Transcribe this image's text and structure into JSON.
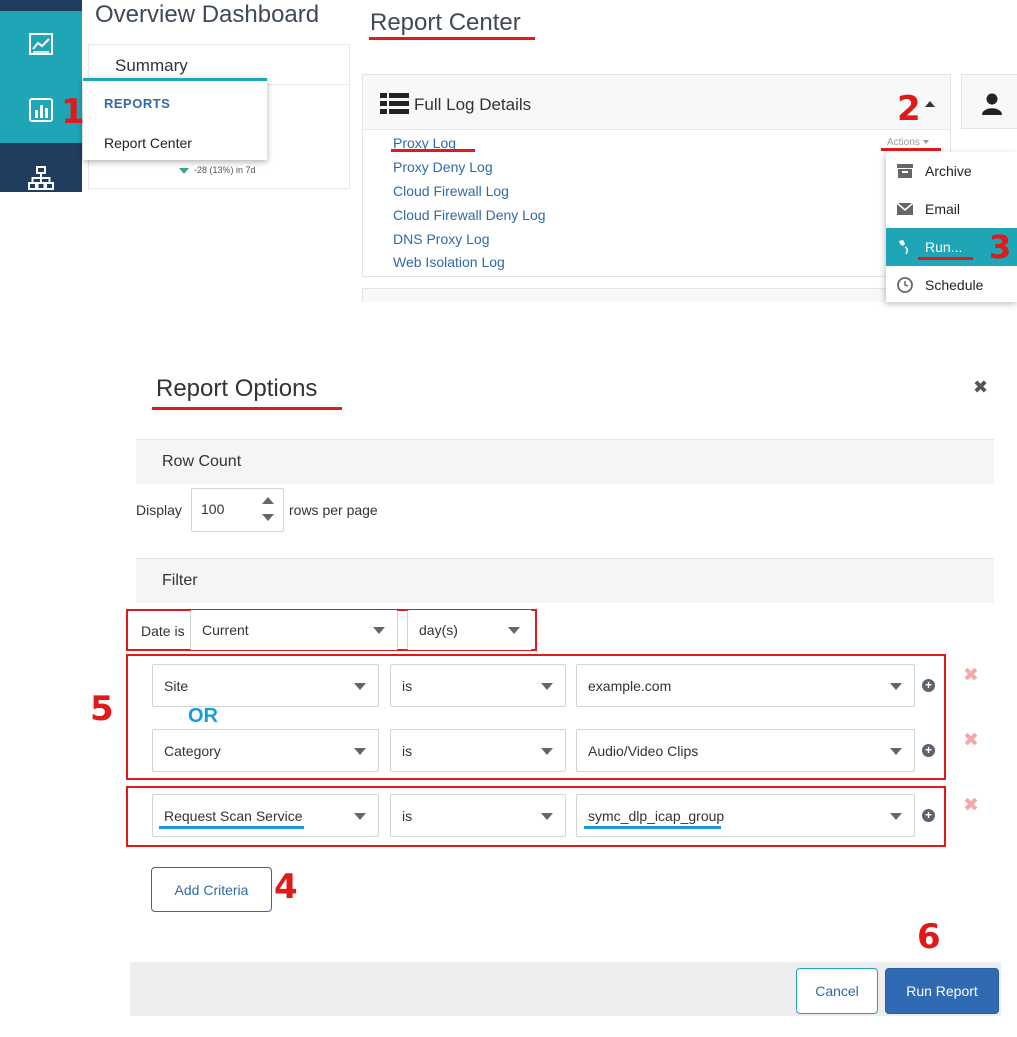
{
  "dashboard": {
    "title": "Overview Dashboard",
    "summary_title": "Summary",
    "summary_delta": "-28 (13%) in 7d",
    "nav_icons": [
      "analytics-icon",
      "reports-icon",
      "network-icon"
    ]
  },
  "reports_flyout": {
    "heading": "REPORTS",
    "item": "Report Center"
  },
  "report_center": {
    "title": "Report Center",
    "panel_title": "Full Log Details",
    "links": [
      "Proxy Log",
      "Proxy Deny Log",
      "Cloud Firewall Log",
      "Cloud Firewall Deny Log",
      "DNS Proxy Log",
      "Web Isolation Log"
    ],
    "actions_label": "Actions",
    "actions_menu": [
      "Archive",
      "Email",
      "Run...",
      "Schedule"
    ]
  },
  "report_options": {
    "title": "Report Options",
    "row_count_heading": "Row Count",
    "display_label": "Display",
    "rows_value": "100",
    "rows_suffix": "rows per page",
    "filter_heading": "Filter",
    "date_label": "Date is",
    "date_value": "Current",
    "date_unit": "day(s)",
    "criteria": [
      {
        "field": "Site",
        "op": "is",
        "value": "example.com"
      },
      {
        "field": "Category",
        "op": "is",
        "value": "Audio/Video Clips"
      },
      {
        "field": "Request Scan Service",
        "op": "is",
        "value": "symc_dlp_icap_group"
      }
    ],
    "or_label": "OR",
    "add_criteria": "Add Criteria",
    "cancel": "Cancel",
    "run_report": "Run Report"
  },
  "step_numbers": [
    "1",
    "2",
    "3",
    "4",
    "5",
    "6"
  ],
  "colors": {
    "accent_teal": "#1ea5b6",
    "nav_dark": "#1f3d5f",
    "link_blue": "#2f6aa8",
    "annotation_red": "#e01a1a",
    "annotation_blue": "#1a9ad6"
  }
}
